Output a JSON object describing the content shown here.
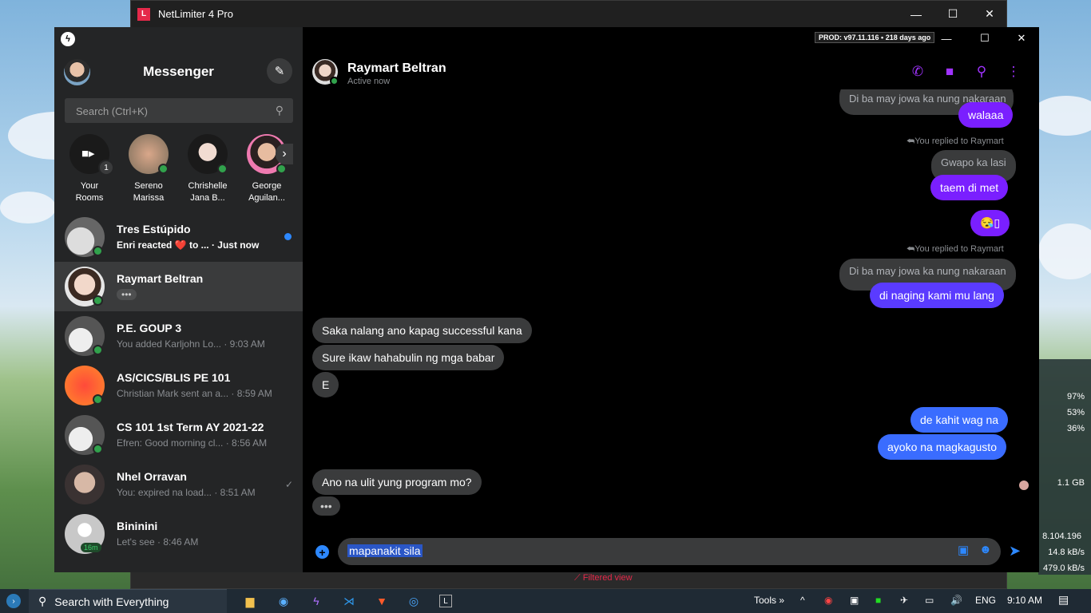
{
  "netlimiter": {
    "title": "NetLimiter 4 Pro",
    "logo": "L",
    "filtered_view": "Filtered view",
    "stats": [
      "97%",
      "53%",
      "36%",
      "1.1 GB",
      "8.104.196",
      "14.8 kB/s",
      "479.0 kB/s"
    ]
  },
  "messenger": {
    "title": "Messenger",
    "search_placeholder": "Search (Ctrl+K)",
    "prod_badge": "PROD: v97.11.116 • 218 days ago",
    "rooms": [
      {
        "label": "Your Rooms",
        "badge": "1"
      },
      {
        "label": "Sereno Marissa"
      },
      {
        "label": "Chrishelle Jana B..."
      },
      {
        "label": "George Aguilan..."
      }
    ],
    "conversations": [
      {
        "name": "Tres Estúpido",
        "snippet": "Enri reacted ❤️ to ... · Just now",
        "unread": true
      },
      {
        "name": "Raymart Beltran",
        "snippet": "•••",
        "active": true
      },
      {
        "name": "P.E. GOUP 3",
        "snippet": "You added Karljohn Lo... · 9:03 AM"
      },
      {
        "name": "AS/CICS/BLIS PE 101",
        "snippet": "Christian Mark sent an a... · 8:59 AM"
      },
      {
        "name": "CS 101 1st Term AY 2021-22",
        "snippet": "Efren: Good morning cl... · 8:56 AM"
      },
      {
        "name": "Nhel Orravan",
        "snippet": "You: expired na load... · 8:51 AM"
      },
      {
        "name": "Bininini",
        "snippet": "Let's see · 8:46 AM",
        "badge": "16m"
      }
    ]
  },
  "chat": {
    "contact_name": "Raymart Beltran",
    "contact_status": "Active now",
    "messages": {
      "quote_top": "Di ba may jowa ka nung nakaraan",
      "out1": "walaaa",
      "reply1": "You replied to Raymart",
      "quote1": "Gwapo ka lasi",
      "out2": "taem di met",
      "out3": "😪▯",
      "reply2": "You replied to Raymart",
      "quote2": "Di ba may jowa ka nung nakaraan",
      "out4": "di naging kami mu lang",
      "in1": "Saka nalang ano kapag successful kana",
      "in2": "Sure ikaw hahabulin ng mga babar",
      "in3": "E",
      "out5": "de kahit wag na",
      "out6": "ayoko na magkagusto",
      "in4": "Ano na ulit yung program mo?",
      "typing": "•••"
    },
    "composer_text": "mapanakit sila"
  },
  "taskbar": {
    "search_label": "Search with Everything",
    "tools_label": "Tools",
    "lang": "ENG",
    "time": "9:10 AM"
  }
}
